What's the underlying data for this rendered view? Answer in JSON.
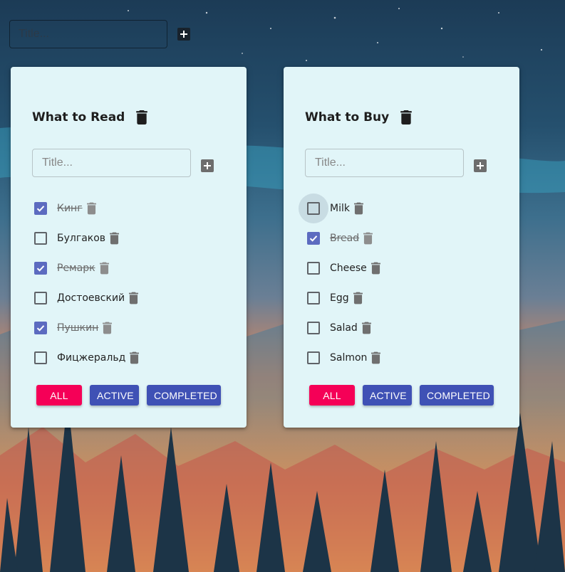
{
  "global_add": {
    "placeholder": "Title..."
  },
  "lists": [
    {
      "title": "What to Read",
      "input_placeholder": "Title...",
      "tasks": [
        {
          "text": "Кинг",
          "done": true
        },
        {
          "text": "Булгаков",
          "done": false
        },
        {
          "text": "Ремарк",
          "done": true
        },
        {
          "text": "Достоевский",
          "done": false
        },
        {
          "text": "Пушкин",
          "done": true
        },
        {
          "text": "Фицжеральд",
          "done": false
        }
      ],
      "filters": {
        "all": "ALL",
        "active": "ACTIVE",
        "completed": "COMPLETED"
      }
    },
    {
      "title": "What to Buy",
      "input_placeholder": "Title...",
      "tasks": [
        {
          "text": "Milk",
          "done": false
        },
        {
          "text": "Bread",
          "done": true
        },
        {
          "text": "Cheese",
          "done": false
        },
        {
          "text": "Egg",
          "done": false
        },
        {
          "text": "Salad",
          "done": false
        },
        {
          "text": "Salmon",
          "done": false
        }
      ],
      "filters": {
        "all": "ALL",
        "active": "ACTIVE",
        "completed": "COMPLETED"
      }
    }
  ],
  "colors": {
    "card_bg": "#e1f5f8",
    "filter_all": "#f50057",
    "filter_other": "#3f51b5",
    "checkbox_checked": "#5c6bc0"
  },
  "icons": {
    "add": "plus-box-icon",
    "delete": "trash-icon",
    "checked": "check-icon"
  }
}
